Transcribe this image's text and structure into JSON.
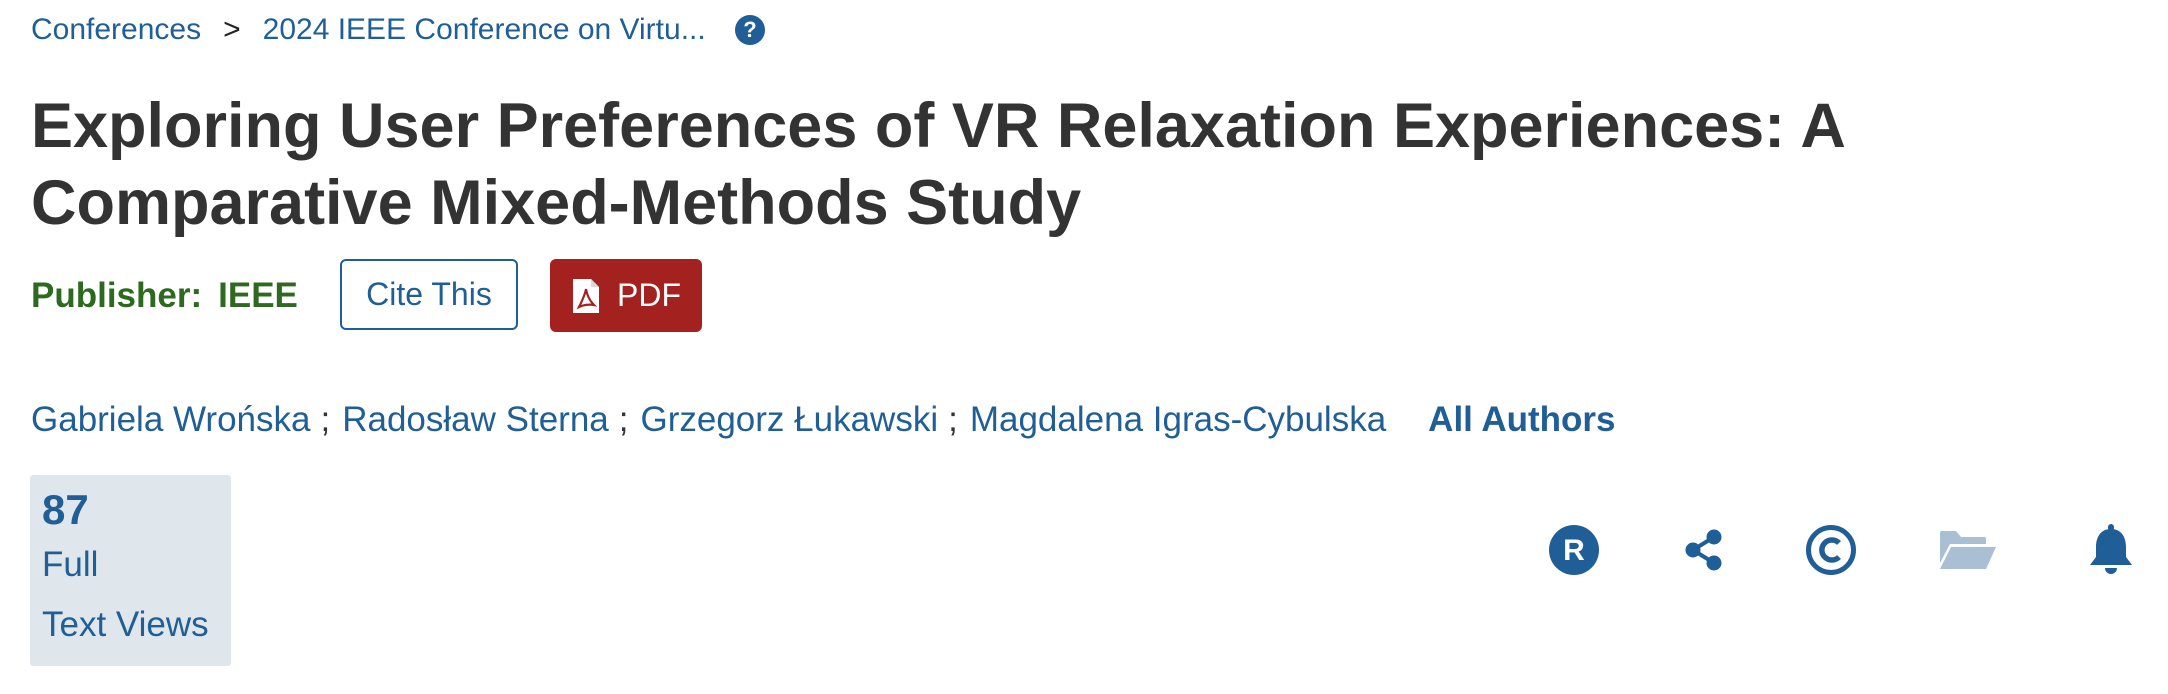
{
  "breadcrumb": {
    "items": [
      "Conferences",
      "2024 IEEE Conference on Virtu..."
    ],
    "separator": ">",
    "help_icon": "question-circle-icon"
  },
  "article": {
    "title": "Exploring User Preferences of VR Relaxation Experiences: A Comparative Mixed-Methods Study"
  },
  "publisher": {
    "label": "Publisher:",
    "name": "IEEE"
  },
  "actions": {
    "cite_label": "Cite This",
    "pdf_label": "PDF",
    "pdf_icon": "pdf-file-icon"
  },
  "authors": {
    "list": [
      "Gabriela Wrońska",
      "Radosław Sterna",
      "Grzegorz Łukawski",
      "Magdalena Igras-Cybulska"
    ],
    "separator": ";",
    "all_label": "All Authors"
  },
  "metrics": {
    "count": "87",
    "label_line1": "Full",
    "label_line2": "Text Views"
  },
  "toolbar": {
    "icons": [
      "rights-r-icon",
      "share-icon",
      "copyright-icon",
      "folder-open-icon",
      "bell-icon"
    ]
  },
  "colors": {
    "link": "#1f5e96",
    "publisher_green": "#2d6a1f",
    "pdf_red": "#a3211f",
    "metric_bg": "#dfe6ec",
    "folder_disabled": "#a9bfd3"
  }
}
